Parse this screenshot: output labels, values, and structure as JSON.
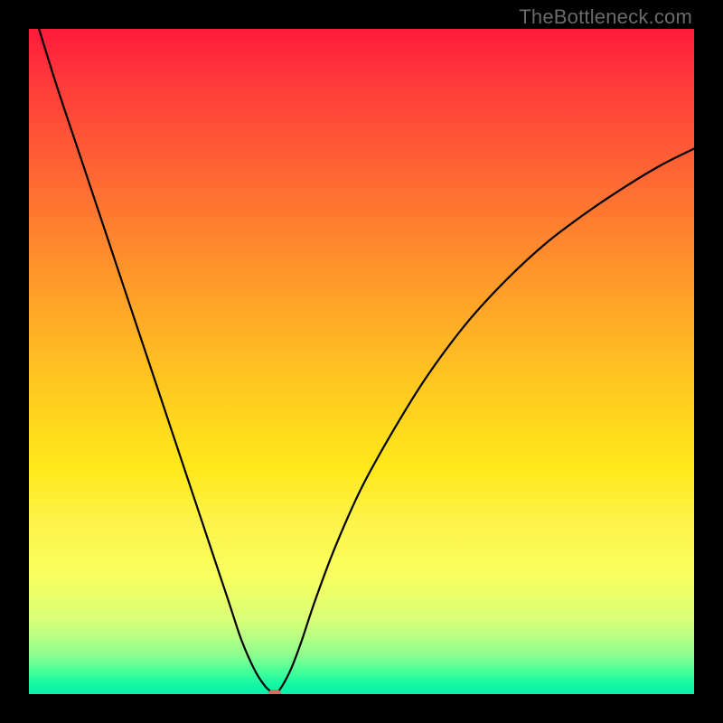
{
  "watermark": "TheBottleneck.com",
  "colors": {
    "page_bg": "#000000",
    "curve": "#000000",
    "marker": "#d96a5e"
  },
  "chart_data": {
    "type": "line",
    "title": "",
    "xlabel": "",
    "ylabel": "",
    "xlim": [
      0,
      100
    ],
    "ylim": [
      0,
      100
    ],
    "series": [
      {
        "name": "bottleneck-curve",
        "x": [
          0,
          4,
          8,
          12,
          16,
          20,
          24,
          27,
          30,
          32,
          34,
          35.5,
          36.5,
          37,
          37.5,
          38.3,
          39.5,
          41,
          43,
          46,
          50,
          55,
          60,
          66,
          72,
          78,
          84,
          90,
          95,
          100
        ],
        "y": [
          105,
          92,
          80,
          68,
          56,
          44,
          32,
          23,
          14,
          8,
          3.5,
          1.2,
          0.3,
          0,
          0.4,
          1.6,
          4,
          8,
          14,
          22,
          31,
          40,
          48,
          56,
          62.5,
          68,
          72.5,
          76.5,
          79.5,
          82
        ]
      }
    ],
    "marker": {
      "x": 37,
      "y": 0
    }
  }
}
